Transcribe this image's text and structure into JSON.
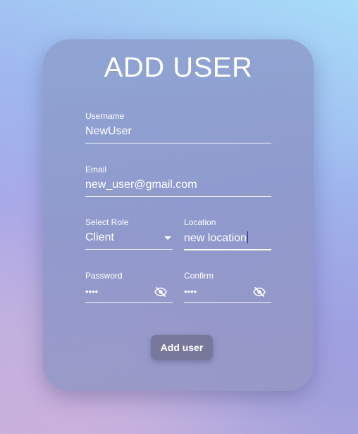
{
  "form": {
    "title": "ADD USER",
    "username": {
      "label": "Username",
      "value": "NewUser"
    },
    "email": {
      "label": "Email",
      "value": "new_user@gmail.com"
    },
    "role": {
      "label": "Select Role",
      "value": "Client"
    },
    "location": {
      "label": "Location",
      "value": "new location"
    },
    "password": {
      "label": "Password",
      "value": "••••"
    },
    "confirm": {
      "label": "Confirm",
      "value": "••••"
    },
    "submit_label": "Add user"
  },
  "icons": {
    "visibility_toggle": "eye-off-icon",
    "dropdown": "caret-down-icon"
  },
  "colors": {
    "text": "#ffffff",
    "focus_caret": "#1f2b6a"
  }
}
